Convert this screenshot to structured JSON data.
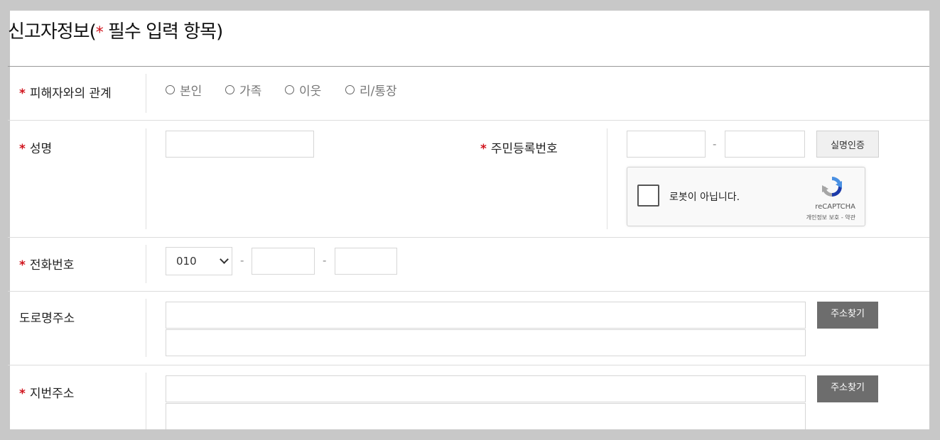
{
  "header": {
    "title_prefix": "신고자정보(",
    "required_star": "*",
    "title_suffix": " 필수 입력 항목)"
  },
  "relation": {
    "label": "피해자와의 관계",
    "options": [
      "본인",
      "가족",
      "이웃",
      "리/통장"
    ]
  },
  "name": {
    "label": "성명",
    "value": ""
  },
  "resident_number": {
    "label": "주민등록번호",
    "separator": "-",
    "verify_button": "실명인증"
  },
  "recaptcha": {
    "checkbox_label": "로봇이 아닙니다.",
    "brand": "reCAPTCHA",
    "terms": "개인정보 보호 - 약관"
  },
  "phone": {
    "label": "전화번호",
    "prefix_selected": "010",
    "separator": "-"
  },
  "road_address": {
    "label": "도로명주소",
    "search_button": "주소찾기"
  },
  "lot_address": {
    "label": "지번주소",
    "search_button": "주소찾기"
  },
  "colors": {
    "required": "#d0121b",
    "dark_button": "#6d6d6d",
    "page_bg": "#c8c8c8"
  }
}
